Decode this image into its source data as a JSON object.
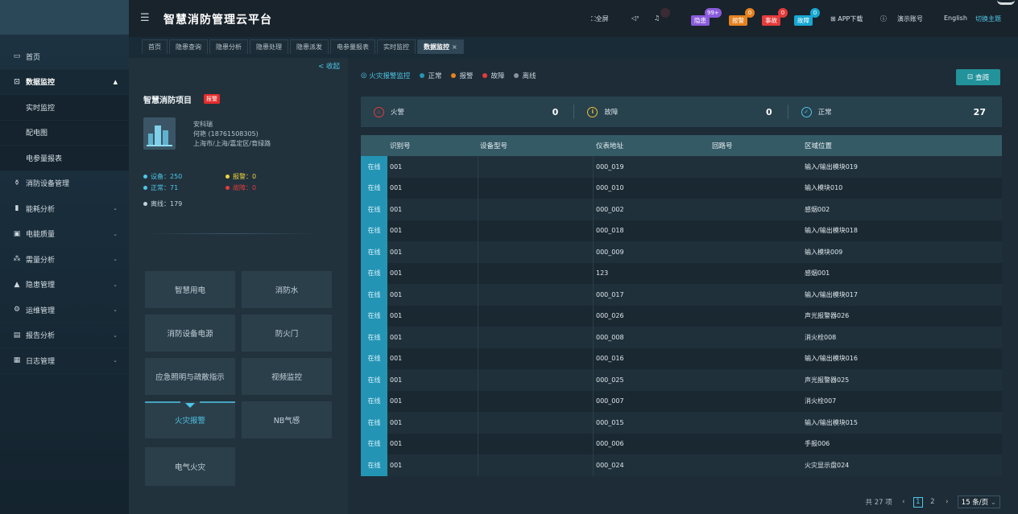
{
  "header": {
    "title": "智慧消防管理云平台",
    "fullscreen": "全屏",
    "badges": {
      "hidden_danger": {
        "label": "隐患",
        "count": "99+"
      },
      "alarm": {
        "label": "报警",
        "count": "0"
      },
      "accident": {
        "label": "事故",
        "count": "0"
      },
      "fault": {
        "label": "故障",
        "count": "0"
      }
    },
    "app_download": "APP下载",
    "demo_account": "演示账号",
    "language": "English",
    "switch_theme": "切换主题"
  },
  "tabs": [
    "首页",
    "隐患查询",
    "隐患分析",
    "隐患处理",
    "隐患派发",
    "电参量报表",
    "实时监控",
    "数据监控"
  ],
  "sidebar": {
    "items": [
      {
        "label": "首页",
        "icon": "home-icon"
      },
      {
        "label": "数据监控",
        "icon": "monitor-icon",
        "expanded": true
      },
      {
        "label": "实时监控",
        "sub": true
      },
      {
        "label": "配电图",
        "sub": true
      },
      {
        "label": "电参量报表",
        "sub": true
      },
      {
        "label": "消防设备管理",
        "icon": "extinguisher-icon"
      },
      {
        "label": "能耗分析",
        "icon": "bar-chart-icon"
      },
      {
        "label": "电能质量",
        "icon": "calendar-icon"
      },
      {
        "label": "需量分析",
        "icon": "network-icon"
      },
      {
        "label": "隐患管理",
        "icon": "warning-icon"
      },
      {
        "label": "运维管理",
        "icon": "tool-icon"
      },
      {
        "label": "报告分析",
        "icon": "report-icon"
      },
      {
        "label": "日志管理",
        "icon": "log-icon"
      }
    ]
  },
  "project": {
    "collapse": "< 收起",
    "name": "智慧消防项目",
    "tag": "报警",
    "contact_company": "安科瑞",
    "contact_person": "何艳 (18761508305)",
    "address": "上海市/上海/嘉定区/育绿路",
    "stats": {
      "devices": "设备：250",
      "alarm": "报警：0",
      "normal": "正常：71",
      "fault": "故障：0",
      "offline": "离线：179"
    }
  },
  "functions": [
    "智慧用电",
    "消防水",
    "消防设备电源",
    "防火门",
    "应急照明与疏散指示",
    "视频监控",
    "火灾报警",
    "NB气感",
    "电气火灾"
  ],
  "monitor": {
    "title": "火灾报警监控",
    "legend": [
      "正常",
      "报警",
      "故障",
      "离线"
    ],
    "query": "查阅",
    "summary": [
      {
        "label": "火警",
        "value": "0"
      },
      {
        "label": "故障",
        "value": "0"
      },
      {
        "label": "正常",
        "value": "27"
      }
    ],
    "columns": [
      "识别号",
      "设备型号",
      "仪表地址",
      "回路号",
      "区域位置"
    ],
    "rows": [
      {
        "status": "在线",
        "id": "001",
        "model": "",
        "addr": "000_019",
        "loop": "",
        "area": "输入/输出模块019"
      },
      {
        "status": "在线",
        "id": "001",
        "model": "",
        "addr": "000_010",
        "loop": "",
        "area": "输入模块010"
      },
      {
        "status": "在线",
        "id": "001",
        "model": "",
        "addr": "000_002",
        "loop": "",
        "area": "感烟002"
      },
      {
        "status": "在线",
        "id": "001",
        "model": "",
        "addr": "000_018",
        "loop": "",
        "area": "输入/输出模块018"
      },
      {
        "status": "在线",
        "id": "001",
        "model": "",
        "addr": "000_009",
        "loop": "",
        "area": "输入模块009"
      },
      {
        "status": "在线",
        "id": "001",
        "model": "",
        "addr": "123",
        "loop": "",
        "area": "感烟001"
      },
      {
        "status": "在线",
        "id": "001",
        "model": "",
        "addr": "000_017",
        "loop": "",
        "area": "输入/输出模块017"
      },
      {
        "status": "在线",
        "id": "001",
        "model": "",
        "addr": "000_026",
        "loop": "",
        "area": "声光报警器026"
      },
      {
        "status": "在线",
        "id": "001",
        "model": "",
        "addr": "000_008",
        "loop": "",
        "area": "消火栓008"
      },
      {
        "status": "在线",
        "id": "001",
        "model": "",
        "addr": "000_016",
        "loop": "",
        "area": "输入/输出模块016"
      },
      {
        "status": "在线",
        "id": "001",
        "model": "",
        "addr": "000_025",
        "loop": "",
        "area": "声光报警器025"
      },
      {
        "status": "在线",
        "id": "001",
        "model": "",
        "addr": "000_007",
        "loop": "",
        "area": "消火栓007"
      },
      {
        "status": "在线",
        "id": "001",
        "model": "",
        "addr": "000_015",
        "loop": "",
        "area": "输入/输出模块015"
      },
      {
        "status": "在线",
        "id": "001",
        "model": "",
        "addr": "000_006",
        "loop": "",
        "area": "手报006"
      },
      {
        "status": "在线",
        "id": "001",
        "model": "",
        "addr": "000_024",
        "loop": "",
        "area": "火灾显示盘024"
      }
    ],
    "pager": {
      "total": "共 27 项",
      "pages": [
        "1",
        "2"
      ],
      "page_size": "15 条/页"
    }
  },
  "colors": {
    "accent": "#4fc6e6",
    "online": "#2494b4",
    "alarm": "#e5821f",
    "fault": "#e53b3b",
    "offline": "#8a949a",
    "query": "#22929b"
  }
}
